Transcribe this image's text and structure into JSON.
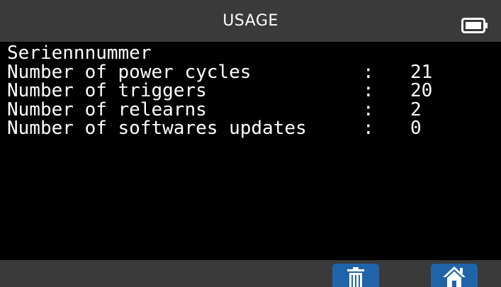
{
  "header": {
    "title": "USAGE",
    "battery_icon": "battery-full-icon"
  },
  "content": {
    "heading": "Seriennnummer",
    "rows": [
      {
        "label": "Number of power cycles",
        "separator": ":",
        "value": "21"
      },
      {
        "label": "Number of triggers",
        "separator": ":",
        "value": "20"
      },
      {
        "label": "Number of relearns",
        "separator": ":",
        "value": "2"
      },
      {
        "label": "Number of softwares updates",
        "separator": ":",
        "value": "0"
      }
    ]
  },
  "footer": {
    "buttons": [
      {
        "name": "delete",
        "icon": "trash-icon"
      },
      {
        "name": "home",
        "icon": "home-icon"
      }
    ]
  },
  "colors": {
    "background": "#000000",
    "bar": "#3a3a3a",
    "button": "#1f64a9",
    "text": "#ffffff"
  }
}
